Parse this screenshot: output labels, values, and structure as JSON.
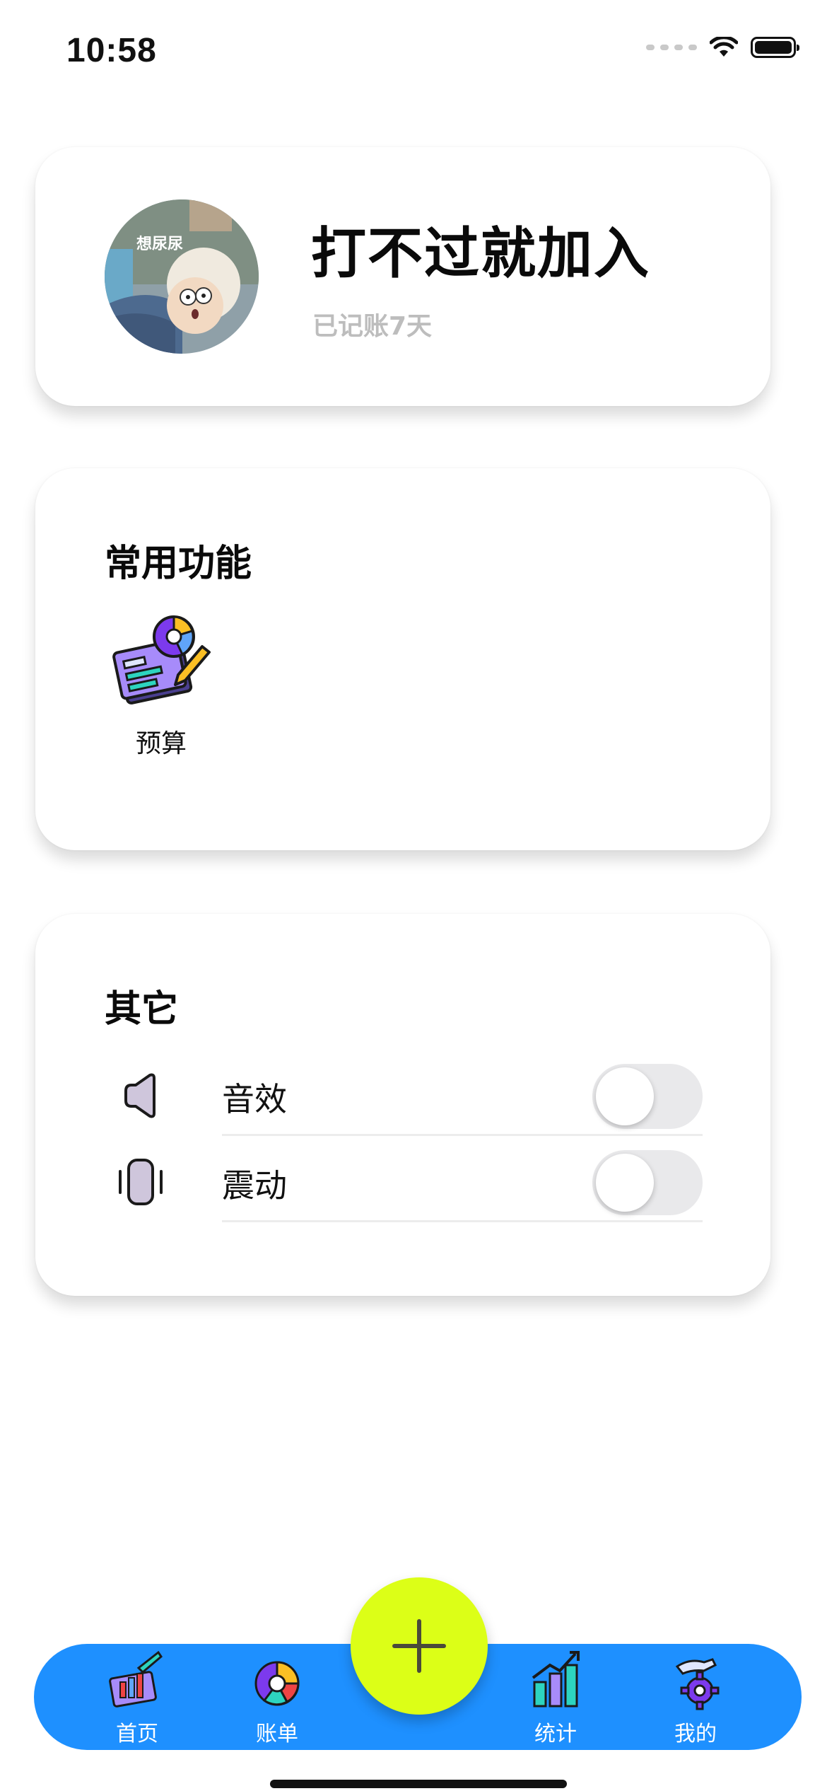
{
  "status_bar": {
    "time": "10:58"
  },
  "profile": {
    "avatar_caption": "想尿尿",
    "username": "打不过就加入",
    "days_recorded": "已记账7天"
  },
  "functions": {
    "title": "常用功能",
    "items": [
      {
        "label": "预算",
        "icon": "budget-icon"
      }
    ]
  },
  "other": {
    "title": "其它",
    "settings": [
      {
        "label": "音效",
        "icon": "speaker-icon",
        "enabled": false
      },
      {
        "label": "震动",
        "icon": "vibration-icon",
        "enabled": false
      }
    ]
  },
  "tabbar": {
    "tabs": [
      {
        "label": "首页",
        "icon": "home-chart-icon"
      },
      {
        "label": "账单",
        "icon": "pie-chart-icon"
      },
      {
        "label": "统计",
        "icon": "bar-chart-icon"
      },
      {
        "label": "我的",
        "icon": "gear-hand-icon"
      }
    ],
    "add_button_icon": "plus-icon"
  },
  "colors": {
    "tabbar_bg": "#1e90ff",
    "fab_bg": "#dcff17",
    "toggle_off": "#e9e9eb",
    "subtitle_gray": "#bdbdbd"
  }
}
